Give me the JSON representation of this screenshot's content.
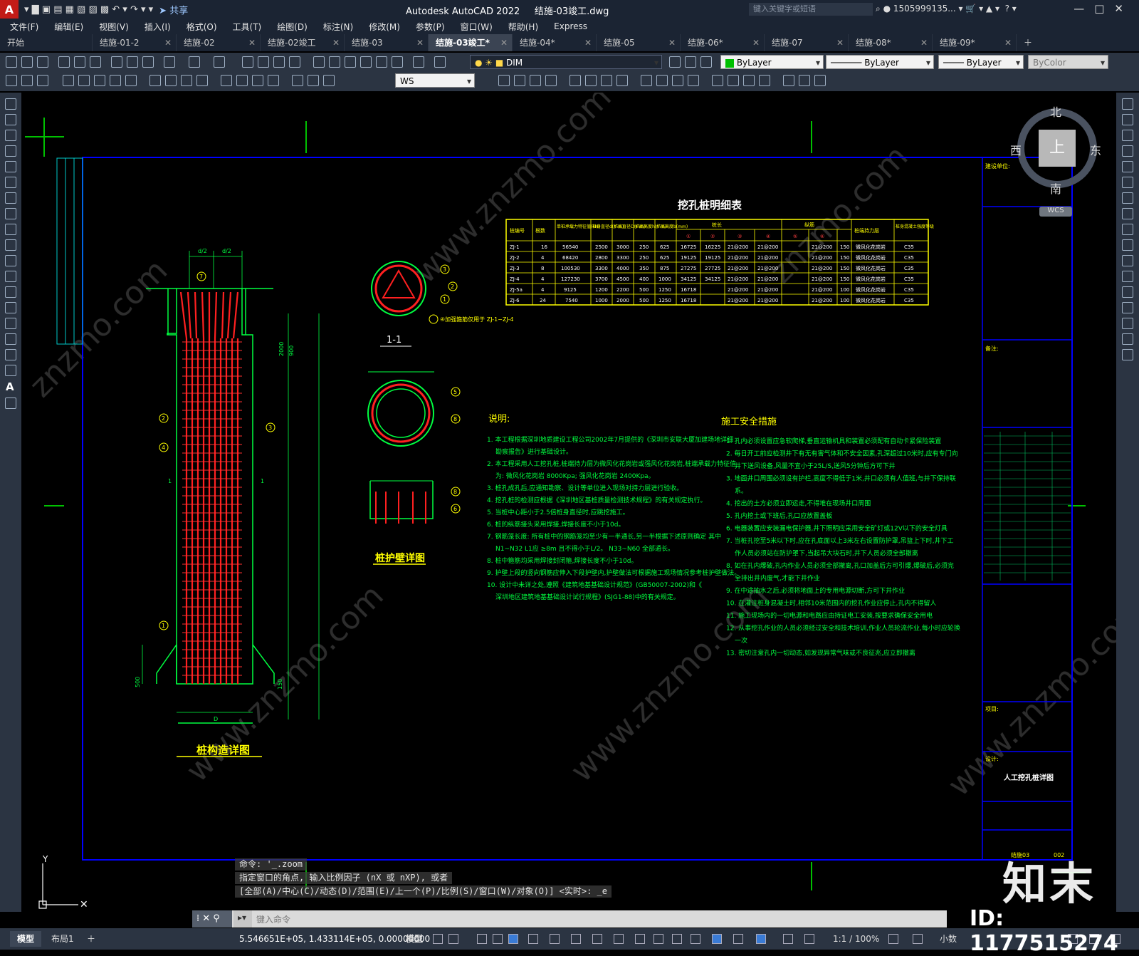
{
  "app": {
    "title": "Autodesk AutoCAD 2022",
    "filename": "结施-03竣工.dwg",
    "share_label": "共享",
    "search_placeholder": "键入关键字或短语",
    "user": "1505999135..."
  },
  "menu": [
    "文件(F)",
    "编辑(E)",
    "视图(V)",
    "插入(I)",
    "格式(O)",
    "工具(T)",
    "绘图(D)",
    "标注(N)",
    "修改(M)",
    "参数(P)",
    "窗口(W)",
    "帮助(H)",
    "Express"
  ],
  "tabs": [
    {
      "label": "开始"
    },
    {
      "label": "结施-01-2"
    },
    {
      "label": "结施-02"
    },
    {
      "label": "结施-02竣工"
    },
    {
      "label": "结施-03"
    },
    {
      "label": "结施-03竣工*"
    },
    {
      "label": "结施-04*"
    },
    {
      "label": "结施-05"
    },
    {
      "label": "结施-06*"
    },
    {
      "label": "结施-07"
    },
    {
      "label": "结施-08*"
    },
    {
      "label": "结施-09*"
    }
  ],
  "toolbar": {
    "layer_value": "DIM",
    "color_value": "ByLayer",
    "linetype_value": "ByLayer",
    "lineweight_value": "ByLayer",
    "plotstyle_value": "ByColor",
    "ucs_value": "WS"
  },
  "viewcube": {
    "north": "北",
    "south": "南",
    "east": "东",
    "west": "西",
    "top": "上",
    "wcs": "WCS"
  },
  "drawing": {
    "table_title": "挖孔桩明细表",
    "table_headers": [
      "桩编号",
      "根数",
      "单桩承载力特征值(kN)",
      "桩身直径d(mm)",
      "扩底直径D(mm)",
      "扩底高度h(mm)",
      "扩底高度b(mm)",
      "桩长",
      "桩长",
      "桩长",
      "桩长",
      "纵筋",
      "纵筋",
      "桩端持力层",
      "桩身混凝土强度等级"
    ],
    "table_rows": [
      [
        "ZJ-1",
        "16",
        "56540",
        "2500",
        "3000",
        "250",
        "625",
        "16725",
        "16225",
        "21@200",
        "21@200",
        "21@200",
        "150",
        "微风化花岗岩",
        "C35"
      ],
      [
        "ZJ-2",
        "4",
        "68420",
        "2800",
        "3300",
        "250",
        "625",
        "19125",
        "19125",
        "21@200",
        "21@200",
        "21@200",
        "150",
        "微风化花岗岩",
        "C35"
      ],
      [
        "ZJ-3",
        "8",
        "100530",
        "3300",
        "4000",
        "350",
        "875",
        "27275",
        "27725",
        "21@200",
        "21@200",
        "21@200",
        "150",
        "微风化花岗岩",
        "C35"
      ],
      [
        "ZJ-4",
        "4",
        "127230",
        "3700",
        "4500",
        "400",
        "1000",
        "34125",
        "34125",
        "21@200",
        "21@200",
        "21@200",
        "150",
        "微风化花岗岩",
        "C35"
      ],
      [
        "ZJ-5a",
        "4",
        "9125",
        "1200",
        "2200",
        "500",
        "1250",
        "16718",
        "",
        "21@200",
        "21@200",
        "21@200",
        "100",
        "微风化花岗岩",
        "C35"
      ],
      [
        "ZJ-6",
        "24",
        "7540",
        "1000",
        "2000",
        "500",
        "1250",
        "16718",
        "",
        "21@200",
        "21@200",
        "21@200",
        "100",
        "微风化花岗岩",
        "C35"
      ]
    ],
    "pile_detail_title": "桩构造详图",
    "section_label": "1-1",
    "wall_detail_title": "桩护壁详图",
    "note_section_label": "④加强箍筋仅用于 ZJ-1~ZJ-4",
    "notes_title": "说明:",
    "notes": [
      "1. 本工程根据深圳地质建设工程公司2002年7月提供的《深圳市安联大厦加建场地详细勘察报告》进行基础设计。",
      "2. 本工程采用人工挖孔桩,桩端持力层为微风化花岗岩或强风化花岗岩,桩端承载力特征值为: 微风化花岗岩 8000Kpa; 强风化花岗岩 2400Kpa。",
      "3. 桩孔成孔后,应通知勘察、设计等单位进入现场对持力层进行验收。",
      "4. 挖孔桩的检测应根据《深圳地区基桩质量检测技术规程》的有关规定执行。",
      "5. 当桩中心距小于2.5倍桩身直径时,应跳挖施工。",
      "6. 桩的纵筋接头采用焊接,焊接长度不小于10d。",
      "7. 钢筋笼长度: 所有桩中的钢筋笼均至少有一半通长,另一半根据下述原则确定 其中 N1~N32 L1应 ≥8m 且不得小于L/2。 N33~N60 全部通长。",
      "8. 桩中箍筋均采用焊接封闭箍,焊接长度不小于10d。",
      "9. 护壁上段的竖向钢筋应伸入下段护壁内,护壁做法可根据施工现场情况参考桩护壁做法。",
      "10. 设计中未详之处,遵照《建筑地基基础设计规范》(GB50007-2002)和《深圳地区建筑地基基础设计试行规程》(SJG1-88)中的有关规定。"
    ],
    "safety_title": "施工安全措施",
    "safety": [
      "1. 孔内必须设置应急软爬梯,垂直运输机具和装置必须配有自动卡紧保险装置",
      "2. 每日开工前应检测井下有无有害气体和不安全因素,孔深超过10米时,应有专门向井下送风设备,风量不宜小于25L/S,送风5分钟后方可下井",
      "3. 地面井口周围必须设有护栏,高度不得低于1米,井口必须有人值班,与井下保持联系。",
      "4. 挖出的土方必须立即运走,不得堆在现场井口周围",
      "5. 孔内挖土或下班后,孔口应放置盖板",
      "6. 电器装置应安装漏电保护器,井下照明应采用安全矿灯或12V以下的安全灯具",
      "7. 当桩孔挖至5米以下时,应在孔底面以上3米左右设置防护罩,吊篮上下时,井下工作人员必须站在防护罩下,当起吊大块石时,井下人员必须全部撤离",
      "8. 如在孔内爆破,孔内作业人员必须全部撤离,孔口加盖后方可引爆,爆破后,必须完全排出井内废气,才能下井作业",
      "9. 在中途抽水之后,必须将地面上的专用电源切断,方可下井作业",
      "10. 在灌注桩身混凝土时,相邻10米范围内的挖孔作业应停止,孔内不得留人",
      "11. 施工现场内的一切电源和电路应由持证电工安装,按要求确保安全用电",
      "12. 从事挖孔作业的人员必须经过安全和技术培训,作业人员轮流作业,每小时应轮换一次",
      "13. 密切注意孔内一切动态,如发现异常气味或不良征兆,应立即撤离"
    ],
    "title_block": {
      "drawing_name": "人工挖孔桩详图",
      "sheet_no": "结施03",
      "rev": "002",
      "remark_label": "备注:",
      "design_label": "设计:",
      "project_label": "项目:",
      "client_label": "建设单位:"
    },
    "rebar_labels": [
      "1",
      "2",
      "3",
      "4",
      "5",
      "6",
      "7",
      "8"
    ],
    "dim_labels": [
      "d/2",
      "d/2",
      "D",
      "2000",
      "900",
      "500",
      "150",
      "1"
    ]
  },
  "command": {
    "history": [
      "命令: '_.zoom",
      "指定窗口的角点, 输入比例因子 (nX 或 nXP), 或者",
      "[全部(A)/中心(C)/动态(D)/范围(E)/上一个(P)/比例(S)/窗口(W)/对象(O)] <实时>: _e"
    ],
    "input_placeholder": "键入命令"
  },
  "status": {
    "layout_tabs": [
      "模型",
      "布局1"
    ],
    "coords": "5.546651E+05, 1.433114E+05, 0.00000000",
    "space": "模型",
    "scale": "1:1 / 100%",
    "units": "小数"
  },
  "watermark": {
    "brand": "知末",
    "id_text": "ID: 1177515274"
  },
  "colors": {
    "frame": "#0000ff",
    "green": "#00ff40",
    "yellow": "#ffff00",
    "red": "#ff2020",
    "ui_dark": "#2b3442"
  }
}
